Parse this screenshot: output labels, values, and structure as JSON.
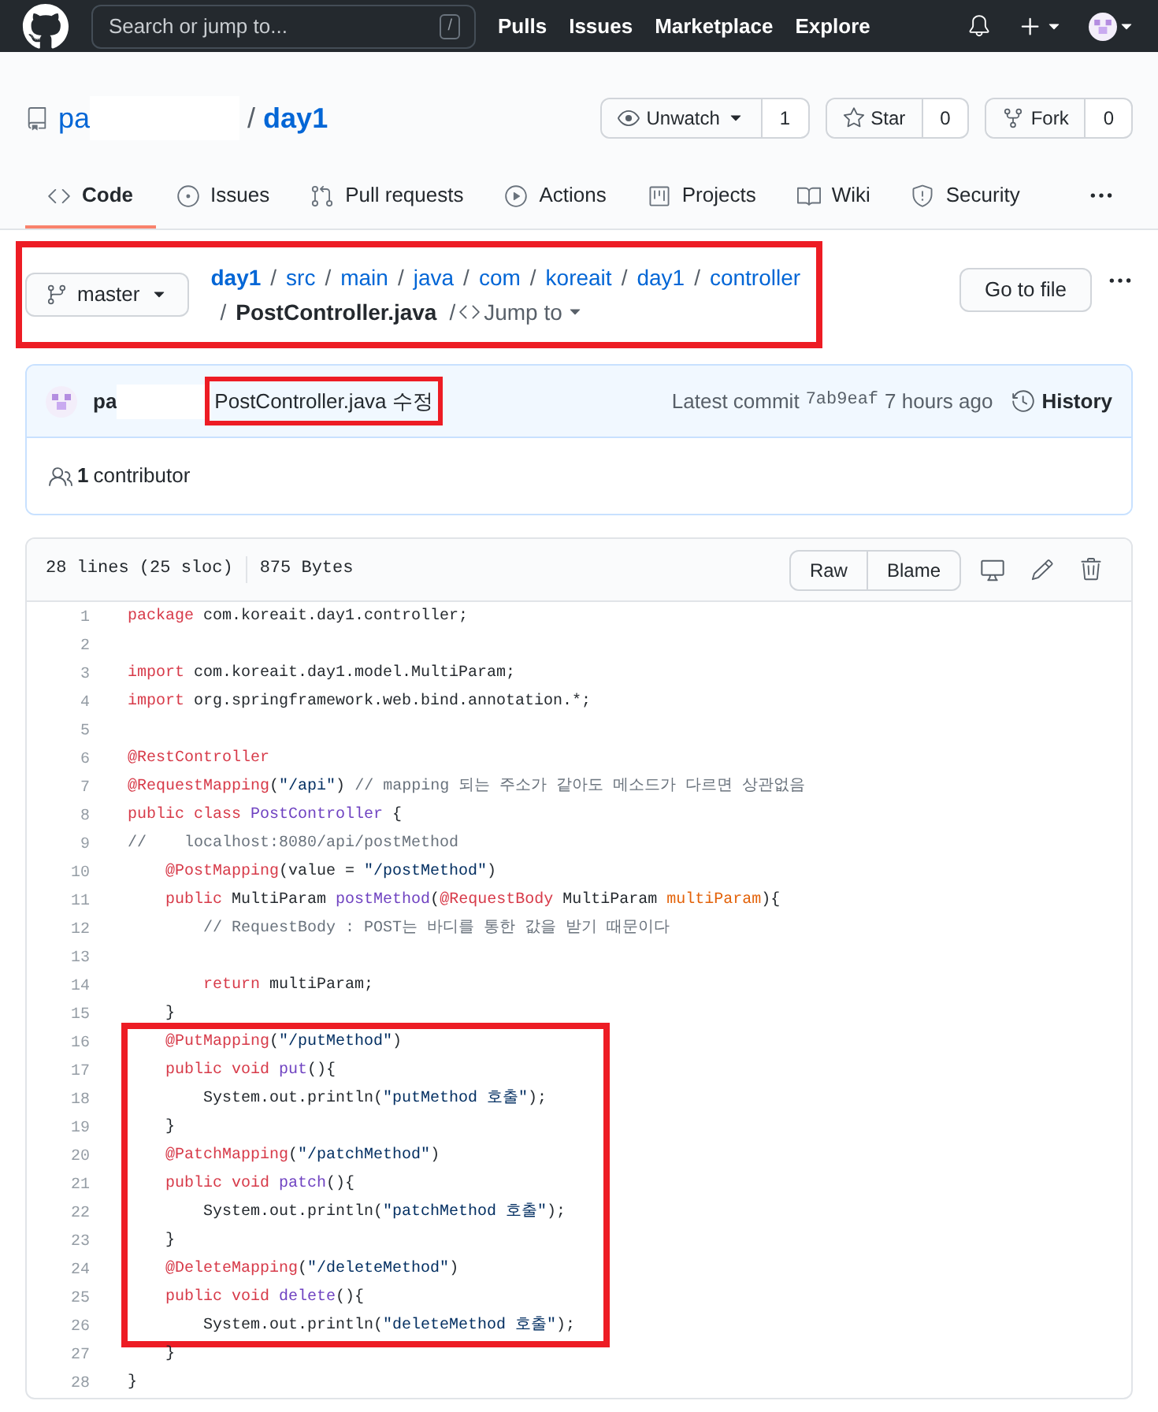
{
  "header": {
    "search": {
      "placeholder": "Search or jump to...",
      "shortcut": "/"
    },
    "nav": [
      "Pulls",
      "Issues",
      "Marketplace",
      "Explore"
    ]
  },
  "repo": {
    "owner": "pa",
    "separator": "/",
    "name": "day1",
    "actions": [
      {
        "kind": "watch",
        "label": "Unwatch",
        "count": "1"
      },
      {
        "kind": "star",
        "label": "Star",
        "count": "0"
      },
      {
        "kind": "fork",
        "label": "Fork",
        "count": "0"
      }
    ]
  },
  "tabs": [
    {
      "label": "Code",
      "selected": true
    },
    {
      "label": "Issues",
      "selected": false
    },
    {
      "label": "Pull requests",
      "selected": false
    },
    {
      "label": "Actions",
      "selected": false
    },
    {
      "label": "Projects",
      "selected": false
    },
    {
      "label": "Wiki",
      "selected": false
    },
    {
      "label": "Security",
      "selected": false
    }
  ],
  "breadcrumb": {
    "highlighted": true,
    "branch": "master",
    "path": [
      {
        "label": "day1",
        "separator": "/"
      },
      {
        "label": "src",
        "separator": "/"
      },
      {
        "label": "main",
        "separator": "/"
      },
      {
        "label": "java",
        "separator": "/"
      },
      {
        "label": "com",
        "separator": "/"
      },
      {
        "label": "koreait",
        "separator": "/"
      },
      {
        "label": "day1",
        "separator": "/"
      },
      {
        "label": "controller",
        "separator": "/"
      }
    ],
    "file": "PostController.java",
    "file_separator": "/",
    "jump": "Jump to"
  },
  "go_to_file": "Go to file",
  "commit": {
    "author": "pa",
    "message": "PostController.java 수정",
    "message_highlighted": true,
    "latest_label": "Latest commit",
    "sha": "7ab9eaf",
    "time": "7 hours ago",
    "history": "History"
  },
  "contributors": {
    "count": "1",
    "label": "contributor"
  },
  "file": {
    "lines_info": "28 lines (25 sloc)",
    "size": "875 Bytes",
    "buttons": [
      "Raw",
      "Blame"
    ]
  },
  "code": [
    {
      "number": "1",
      "highlighted": false,
      "tokens": [
        {
          "kind": "keyword",
          "text": "package"
        },
        {
          "kind": "plain",
          "text": " com.koreait.day1.controller;"
        }
      ]
    },
    {
      "number": "2",
      "highlighted": false
    },
    {
      "number": "3",
      "highlighted": false,
      "tokens": [
        {
          "kind": "keyword",
          "text": "import"
        },
        {
          "kind": "plain",
          "text": " com.koreait.day1.model.MultiParam;"
        }
      ]
    },
    {
      "number": "4",
      "highlighted": false,
      "tokens": [
        {
          "kind": "keyword",
          "text": "import"
        },
        {
          "kind": "plain",
          "text": " org.springframework.web.bind.annotation.*;"
        }
      ]
    },
    {
      "number": "5",
      "highlighted": false
    },
    {
      "number": "6",
      "highlighted": false,
      "tokens": [
        {
          "kind": "keyword",
          "text": "@RestController"
        }
      ]
    },
    {
      "number": "7",
      "highlighted": false,
      "tokens": [
        {
          "kind": "keyword",
          "text": "@RequestMapping"
        },
        {
          "kind": "plain",
          "text": "("
        },
        {
          "kind": "string",
          "text": "\"/api\""
        },
        {
          "kind": "plain",
          "text": ")"
        },
        {
          "kind": "comment",
          "text": " // mapping 되는 주소가 같아도 메소드가 다르면 상관없음"
        }
      ]
    },
    {
      "number": "8",
      "highlighted": false,
      "tokens": [
        {
          "kind": "keyword",
          "text": "public"
        },
        {
          "kind": "keyword",
          "text": " class"
        },
        {
          "kind": "entity",
          "text": " PostController"
        },
        {
          "kind": "plain",
          "text": " {"
        }
      ]
    },
    {
      "number": "9",
      "highlighted": false,
      "tokens": [
        {
          "kind": "comment",
          "text": "//    localhost:8080/api/postMethod"
        }
      ]
    },
    {
      "number": "10",
      "highlighted": false,
      "tokens": [
        {
          "kind": "keyword",
          "text": "    @PostMapping"
        },
        {
          "kind": "plain",
          "text": "(value = "
        },
        {
          "kind": "string",
          "text": "\"/postMethod\""
        },
        {
          "kind": "plain",
          "text": ")"
        }
      ]
    },
    {
      "number": "11",
      "highlighted": false,
      "tokens": [
        {
          "kind": "keyword",
          "text": "    public"
        },
        {
          "kind": "plain",
          "text": " MultiParam "
        },
        {
          "kind": "entity",
          "text": "postMethod"
        },
        {
          "kind": "plain",
          "text": "("
        },
        {
          "kind": "keyword",
          "text": "@RequestBody"
        },
        {
          "kind": "plain",
          "text": " MultiParam "
        },
        {
          "kind": "variable",
          "text": "multiParam"
        },
        {
          "kind": "plain",
          "text": "){"
        }
      ]
    },
    {
      "number": "12",
      "highlighted": false,
      "tokens": [
        {
          "kind": "comment",
          "text": "        // RequestBody : POST는 바디를 통한 값을 받기 때문이다"
        }
      ]
    },
    {
      "number": "13",
      "highlighted": false
    },
    {
      "number": "14",
      "highlighted": false,
      "tokens": [
        {
          "kind": "keyword",
          "text": "        return"
        },
        {
          "kind": "plain",
          "text": " multiParam;"
        }
      ]
    },
    {
      "number": "15",
      "highlighted": false,
      "tokens": [
        {
          "kind": "plain",
          "text": "    }"
        }
      ]
    },
    {
      "number": "16",
      "highlighted": true,
      "tokens": [
        {
          "kind": "keyword",
          "text": "    @PutMapping"
        },
        {
          "kind": "plain",
          "text": "("
        },
        {
          "kind": "string",
          "text": "\"/putMethod\""
        },
        {
          "kind": "plain",
          "text": ")"
        }
      ]
    },
    {
      "number": "17",
      "highlighted": true,
      "tokens": [
        {
          "kind": "keyword",
          "text": "    public"
        },
        {
          "kind": "keyword",
          "text": " void"
        },
        {
          "kind": "entity",
          "text": " put"
        },
        {
          "kind": "plain",
          "text": "(){"
        }
      ]
    },
    {
      "number": "18",
      "highlighted": true,
      "tokens": [
        {
          "kind": "plain",
          "text": "        System.out.println("
        },
        {
          "kind": "string",
          "text": "\"putMethod 호출\""
        },
        {
          "kind": "plain",
          "text": ");"
        }
      ]
    },
    {
      "number": "19",
      "highlighted": true,
      "tokens": [
        {
          "kind": "plain",
          "text": "    }"
        }
      ]
    },
    {
      "number": "20",
      "highlighted": true,
      "tokens": [
        {
          "kind": "keyword",
          "text": "    @PatchMapping"
        },
        {
          "kind": "plain",
          "text": "("
        },
        {
          "kind": "string",
          "text": "\"/patchMethod\""
        },
        {
          "kind": "plain",
          "text": ")"
        }
      ]
    },
    {
      "number": "21",
      "highlighted": true,
      "tokens": [
        {
          "kind": "keyword",
          "text": "    public"
        },
        {
          "kind": "keyword",
          "text": " void"
        },
        {
          "kind": "entity",
          "text": " patch"
        },
        {
          "kind": "plain",
          "text": "(){"
        }
      ]
    },
    {
      "number": "22",
      "highlighted": true,
      "tokens": [
        {
          "kind": "plain",
          "text": "        System.out.println("
        },
        {
          "kind": "string",
          "text": "\"patchMethod 호출\""
        },
        {
          "kind": "plain",
          "text": ");"
        }
      ]
    },
    {
      "number": "23",
      "highlighted": true,
      "tokens": [
        {
          "kind": "plain",
          "text": "    }"
        }
      ]
    },
    {
      "number": "24",
      "highlighted": true,
      "tokens": [
        {
          "kind": "keyword",
          "text": "    @DeleteMapping"
        },
        {
          "kind": "plain",
          "text": "("
        },
        {
          "kind": "string",
          "text": "\"/deleteMethod\""
        },
        {
          "kind": "plain",
          "text": ")"
        }
      ]
    },
    {
      "number": "25",
      "highlighted": true,
      "tokens": [
        {
          "kind": "keyword",
          "text": "    public"
        },
        {
          "kind": "keyword",
          "text": " void"
        },
        {
          "kind": "entity",
          "text": " delete"
        },
        {
          "kind": "plain",
          "text": "(){"
        }
      ]
    },
    {
      "number": "26",
      "highlighted": true,
      "tokens": [
        {
          "kind": "plain",
          "text": "        System.out.println("
        },
        {
          "kind": "string",
          "text": "\"deleteMethod 호출\""
        },
        {
          "kind": "plain",
          "text": ");"
        }
      ]
    },
    {
      "number": "27",
      "highlighted": false,
      "tokens": [
        {
          "kind": "plain",
          "text": "    }"
        }
      ]
    },
    {
      "number": "28",
      "highlighted": false,
      "tokens": [
        {
          "kind": "plain",
          "text": "}"
        }
      ]
    }
  ]
}
